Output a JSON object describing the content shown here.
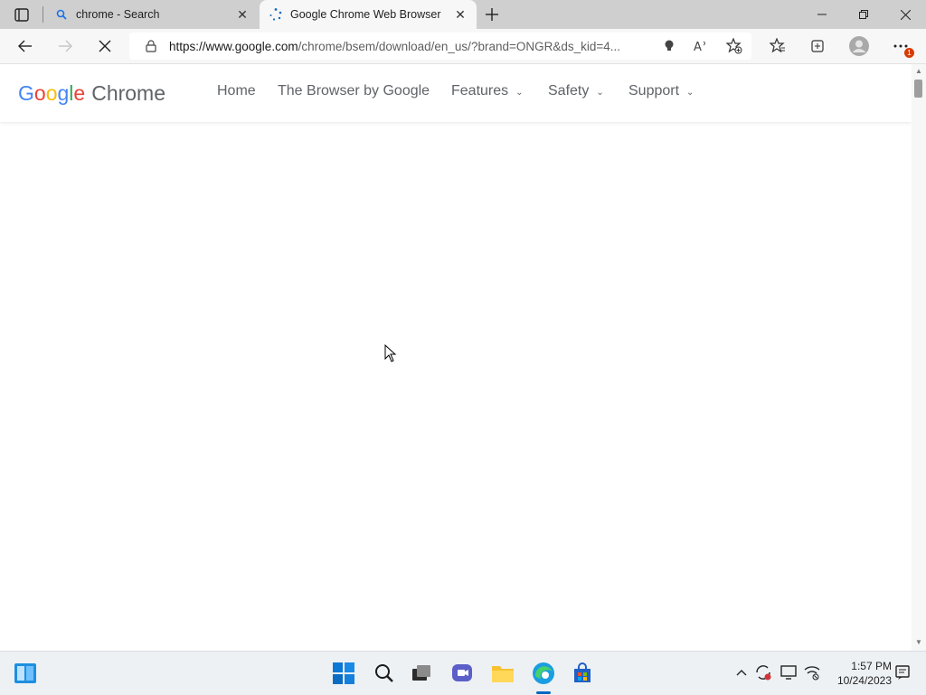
{
  "browser": {
    "tabs": [
      {
        "title": "chrome - Search",
        "favicon": "search-icon",
        "active": false
      },
      {
        "title": "Google Chrome Web Browser",
        "favicon": "loading-spinner-icon",
        "active": true
      }
    ],
    "address_bar": {
      "url_host": "https://www.google.com",
      "url_path": "/chrome/bsem/download/en_us/?brand=ONGR&ds_kid=4..."
    },
    "notification_badge": "1",
    "colors": {
      "tabbar": "#cfcfcf",
      "toolbar": "#f7f7f7",
      "badge": "#d83b01"
    }
  },
  "site": {
    "logo": {
      "google": [
        "G",
        "o",
        "o",
        "g",
        "l",
        "e"
      ],
      "product": "Chrome"
    },
    "nav": [
      {
        "label": "Home",
        "dropdown": false
      },
      {
        "label": "The Browser by Google",
        "dropdown": false
      },
      {
        "label": "Features",
        "dropdown": true
      },
      {
        "label": "Safety",
        "dropdown": true
      },
      {
        "label": "Support",
        "dropdown": true
      }
    ]
  },
  "taskbar": {
    "pinned": [
      "widgets-icon",
      "start-icon",
      "search-icon",
      "task-view-icon",
      "chat-icon",
      "file-explorer-icon",
      "edge-icon",
      "store-icon"
    ],
    "tray": [
      "chevron-up-icon",
      "sync-icon",
      "display-icon",
      "network-icon"
    ],
    "clock": {
      "time": "1:57 PM",
      "date": "10/24/2023"
    }
  }
}
